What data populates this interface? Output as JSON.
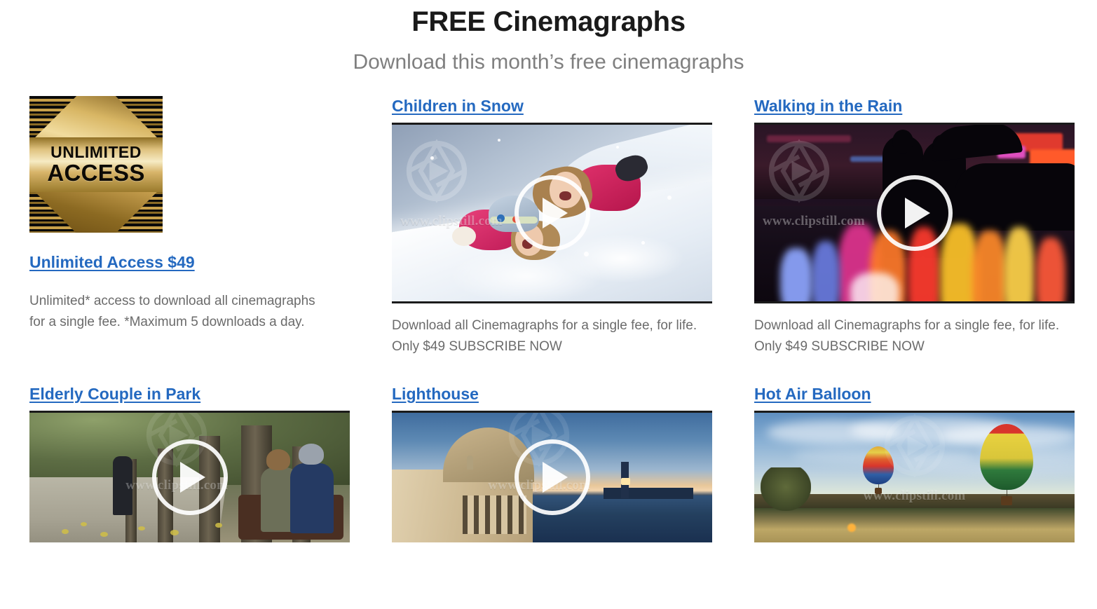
{
  "header": {
    "title": "FREE Cinemagraphs",
    "subtitle": "Download this month’s free cinemagraphs"
  },
  "promo": {
    "badge_line1": "UNLIMITED",
    "badge_line2": "ACCESS",
    "badge_alt": "unlimited-access-badge",
    "title": "Unlimited Access $49",
    "description": "Unlimited* access to download all cinemagraphs\nfor a single fee. *Maximum 5 downloads a day."
  },
  "shared": {
    "watermark": "www.clipstill.com",
    "play_label": "Play"
  },
  "cards": [
    {
      "title": "Children in Snow",
      "description": "Download all Cinemagraphs for a single fee, for life.\nOnly $49 SUBSCRIBE NOW",
      "has_play": true,
      "watermark": "www.clipstill.com"
    },
    {
      "title": "Walking in the Rain",
      "description": "Download all Cinemagraphs for a single fee, for life.\nOnly $49 SUBSCRIBE NOW",
      "has_play": true,
      "watermark": "www.clipstill.com"
    },
    {
      "title": "Elderly Couple in Park",
      "description": "",
      "has_play": true,
      "watermark": "www.clipstill.com"
    },
    {
      "title": "Lighthouse",
      "description": "",
      "has_play": true,
      "watermark": "www.clipstill.com"
    },
    {
      "title": "Hot Air Balloon",
      "description": "",
      "has_play": false,
      "watermark": "www.clipstill.com"
    }
  ],
  "colors": {
    "link": "#2469c0",
    "title_text": "#1a1a1a",
    "subtitle_text": "#7f7f7f",
    "body_text": "#6b6b6b",
    "page_background": "#ffffff",
    "badge_gold": "#c9a451",
    "badge_dark": "#0a0a0a",
    "play_button": "#ffffff"
  }
}
